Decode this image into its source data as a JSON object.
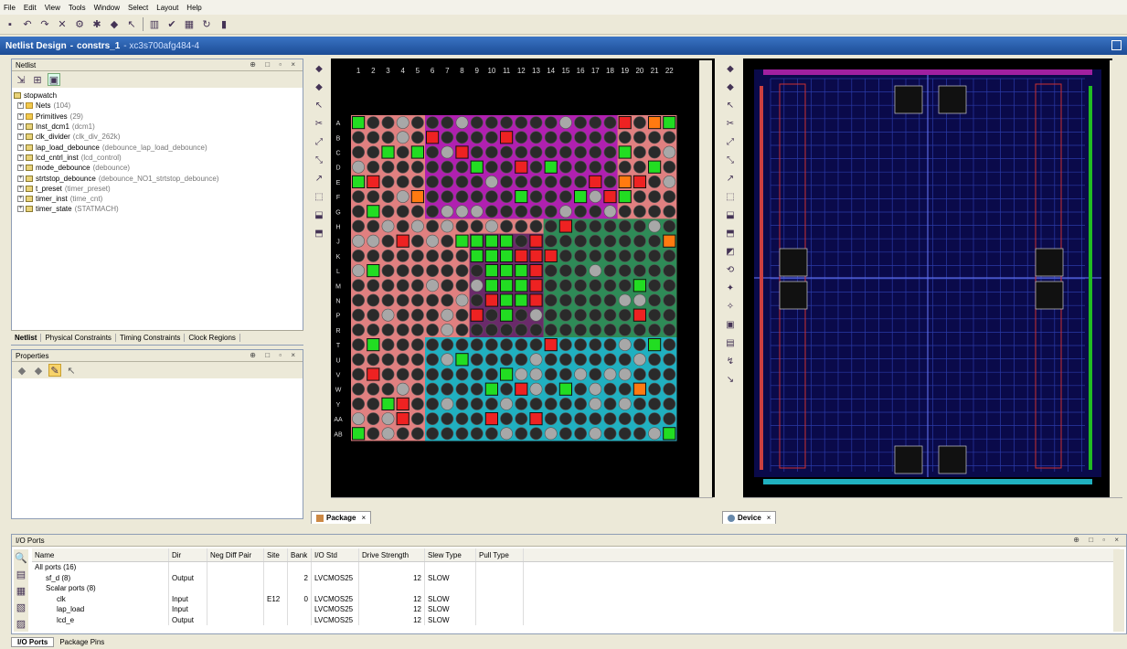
{
  "menu": [
    "File",
    "Edit",
    "View",
    "Tools",
    "Window",
    "Select",
    "Layout",
    "Help"
  ],
  "toolbar_icons": [
    "save-icon",
    "undo-icon",
    "redo-icon",
    "delete-icon",
    "properties-icon",
    "run-icon",
    "route-icon",
    "select-icon",
    "report-icon",
    "check-icon",
    "layout-icon",
    "refresh-icon",
    "chart-icon"
  ],
  "window": {
    "title": "Netlist Design",
    "separator": " - ",
    "name": "constrs_1",
    "part": " - xc3s700afg484-4"
  },
  "netlist": {
    "title": "Netlist",
    "controls": "⊕ □ ▫ ×",
    "tree": [
      {
        "label": "stopwatch",
        "detail": "",
        "level": 0,
        "icon": "inst"
      },
      {
        "label": "Nets",
        "detail": "(104)",
        "level": 1,
        "icon": "folder"
      },
      {
        "label": "Primitives",
        "detail": "(29)",
        "level": 1,
        "icon": "folder"
      },
      {
        "label": "Inst_dcm1",
        "detail": "(dcm1)",
        "level": 1,
        "icon": "inst"
      },
      {
        "label": "clk_divider",
        "detail": "(clk_div_262k)",
        "level": 1,
        "icon": "inst"
      },
      {
        "label": "lap_load_debounce",
        "detail": "(debounce_lap_load_debounce)",
        "level": 1,
        "icon": "inst"
      },
      {
        "label": "lcd_cntrl_inst",
        "detail": "(lcd_control)",
        "level": 1,
        "icon": "inst"
      },
      {
        "label": "mode_debounce",
        "detail": "(debounce)",
        "level": 1,
        "icon": "inst"
      },
      {
        "label": "strtstop_debounce",
        "detail": "(debounce_NO1_strtstop_debounce)",
        "level": 1,
        "icon": "inst"
      },
      {
        "label": "t_preset",
        "detail": "(timer_preset)",
        "level": 1,
        "icon": "inst"
      },
      {
        "label": "timer_inst",
        "detail": "(time_cnt)",
        "level": 1,
        "icon": "inst"
      },
      {
        "label": "timer_state",
        "detail": "(STATMACH)",
        "level": 1,
        "icon": "inst"
      }
    ],
    "tabs": [
      "Netlist",
      "Physical Constraints",
      "Timing Constraints",
      "Clock Regions"
    ]
  },
  "properties": {
    "title": "Properties",
    "controls": "⊕ □ ▫ ×"
  },
  "package": {
    "tab": "Package",
    "close": "×",
    "col_labels": [
      "1",
      "2",
      "3",
      "4",
      "5",
      "6",
      "7",
      "8",
      "9",
      "10",
      "11",
      "12",
      "13",
      "14",
      "15",
      "16",
      "17",
      "18",
      "19",
      "20",
      "21",
      "22"
    ],
    "row_labels": [
      "A",
      "B",
      "C",
      "D",
      "E",
      "F",
      "G",
      "H",
      "J",
      "K",
      "L",
      "M",
      "N",
      "P",
      "R",
      "T",
      "U",
      "V",
      "W",
      "Y",
      "AA",
      "AB"
    ],
    "bank_colors": {
      "top": "#b020b0",
      "left": "#e08080",
      "right": "#2e8b57",
      "bottom": "#20b0c0",
      "center": "#6a2a6a"
    }
  },
  "device": {
    "tab": "Device",
    "close": "×"
  },
  "io": {
    "title": "I/O Ports",
    "controls": "⊕ □ ▫ ×",
    "columns": [
      "Name",
      "Dir",
      "Neg Diff Pair",
      "Site",
      "Bank",
      "I/O Std",
      "Drive Strength",
      "Slew Type",
      "Pull Type"
    ],
    "rows": [
      {
        "name": "All ports (16)",
        "dir": "",
        "neg": "",
        "site": "",
        "bank": "",
        "std": "",
        "drive": "",
        "slew": "",
        "pull": "",
        "indent": 0
      },
      {
        "name": "sf_d (8)",
        "dir": "Output",
        "neg": "",
        "site": "",
        "bank": "2",
        "std": "LVCMOS25",
        "drive": "12",
        "slew": "SLOW",
        "pull": "",
        "indent": 1
      },
      {
        "name": "Scalar ports (8)",
        "dir": "",
        "neg": "",
        "site": "",
        "bank": "",
        "std": "",
        "drive": "",
        "slew": "",
        "pull": "",
        "indent": 1
      },
      {
        "name": "clk",
        "dir": "Input",
        "neg": "",
        "site": "E12",
        "bank": "0",
        "std": "LVCMOS25",
        "drive": "12",
        "slew": "SLOW",
        "pull": "",
        "indent": 2
      },
      {
        "name": "lap_load",
        "dir": "Input",
        "neg": "",
        "site": "",
        "bank": "",
        "std": "LVCMOS25",
        "drive": "12",
        "slew": "SLOW",
        "pull": "",
        "indent": 2
      },
      {
        "name": "lcd_e",
        "dir": "Output",
        "neg": "",
        "site": "",
        "bank": "",
        "std": "LVCMOS25",
        "drive": "12",
        "slew": "SLOW",
        "pull": "",
        "indent": 2
      }
    ],
    "tabs": [
      "I/O Ports",
      "Package Pins"
    ]
  }
}
